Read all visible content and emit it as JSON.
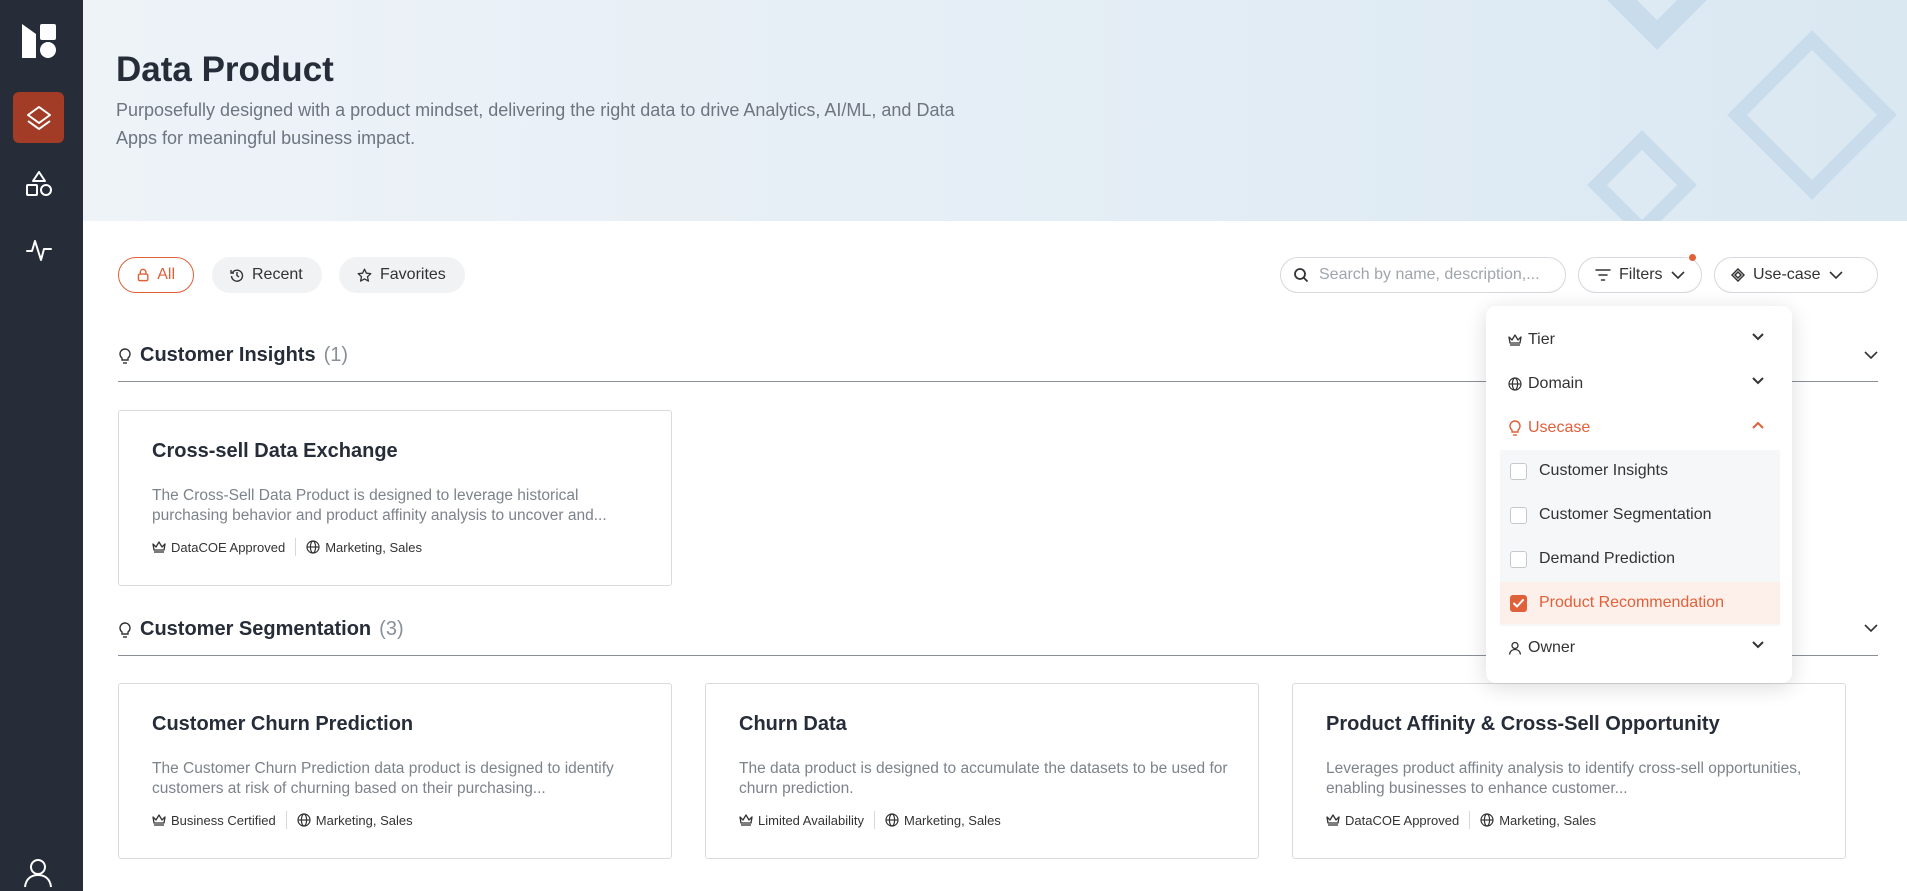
{
  "colors": {
    "accent": "#e0603a",
    "sidebar": "#262d39",
    "sidebar_active": "#a23c27"
  },
  "sidebar": {
    "items": [
      {
        "icon": "data-product-icon",
        "active": true
      },
      {
        "icon": "shapes-icon",
        "active": false
      },
      {
        "icon": "activity-icon",
        "active": false
      }
    ],
    "user_icon": "user-icon"
  },
  "header": {
    "title": "Data Product",
    "subtitle": "Purposefully designed with a product mindset, delivering the right data to drive Analytics, AI/ML, and Data Apps for meaningful business impact."
  },
  "toolbar": {
    "tabs": [
      {
        "label": "All",
        "icon": "lock-icon",
        "active": true
      },
      {
        "label": "Recent",
        "icon": "history-icon",
        "active": false
      },
      {
        "label": "Favorites",
        "icon": "star-icon",
        "active": false
      }
    ],
    "search": {
      "placeholder": "Search by name, description,...",
      "value": ""
    },
    "filters_label": "Filters",
    "usecase_label": "Use-case"
  },
  "filters_dropdown": {
    "groups": [
      {
        "label": "Tier",
        "icon": "crown-icon",
        "expanded": false
      },
      {
        "label": "Domain",
        "icon": "globe-icon",
        "expanded": false
      },
      {
        "label": "Usecase",
        "icon": "bulb-icon",
        "expanded": true
      },
      {
        "label": "Owner",
        "icon": "user-icon",
        "expanded": false
      }
    ],
    "usecase_options": [
      {
        "label": "Customer Insights",
        "checked": false
      },
      {
        "label": "Customer Segmentation",
        "checked": false
      },
      {
        "label": "Demand Prediction",
        "checked": false
      },
      {
        "label": "Product Recommendation",
        "checked": true
      }
    ]
  },
  "sections": [
    {
      "title": "Customer Insights",
      "count": "(1)",
      "cards": [
        {
          "title": "Cross-sell Data Exchange",
          "description": "The Cross-Sell Data Product is designed to leverage historical purchasing behavior and product affinity analysis to uncover and...",
          "tier": "DataCOE Approved",
          "domain": "Marketing, Sales"
        }
      ]
    },
    {
      "title": "Customer Segmentation",
      "count": "(3)",
      "cards": [
        {
          "title": "Customer Churn Prediction",
          "description": "The Customer Churn Prediction data product is designed to identify customers at risk of churning based on their purchasing...",
          "tier": "Business Certified",
          "domain": "Marketing, Sales"
        },
        {
          "title": "Churn Data",
          "description": "The data product is designed to accumulate the datasets to be used for churn prediction.",
          "tier": "Limited Availability",
          "domain": "Marketing, Sales"
        },
        {
          "title": "Product Affinity & Cross-Sell Opportunity",
          "description": "Leverages product affinity analysis to identify cross-sell opportunities, enabling businesses to enhance customer...",
          "tier": "DataCOE Approved",
          "domain": "Marketing, Sales"
        }
      ]
    }
  ]
}
